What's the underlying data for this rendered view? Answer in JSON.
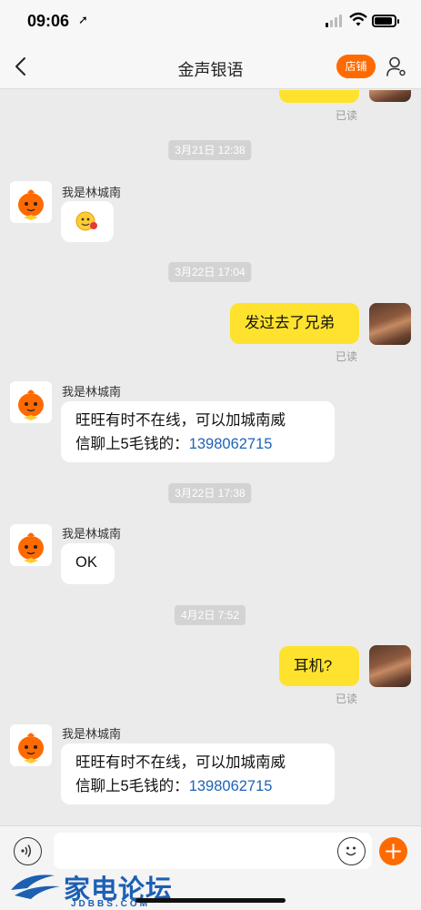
{
  "status_bar": {
    "time": "09:06",
    "arrow": "➚"
  },
  "nav": {
    "title": "金声银语",
    "shop_label": "店铺"
  },
  "messages": {
    "read_label": "已读",
    "sender_name": "我是林城南",
    "time1": "3月21日 12:38",
    "time2": "3月22日 17:04",
    "time3": "3月22日 17:38",
    "time4": "4月2日 7:52",
    "out1": "发过去了兄弟",
    "in_auto_prefix_line1": "旺旺有时不在线，可以加城南威",
    "in_auto_prefix_line2": "信聊上5毛钱的：",
    "phone": "1398062715",
    "ok": "OK",
    "out2": "耳机?"
  },
  "input": {
    "placeholder": ""
  },
  "watermark": {
    "text": "家电论坛",
    "sub": "JDBBS.COM"
  },
  "colors": {
    "accent": "#ff6a00",
    "bubble_out": "#ffe22d",
    "link": "#1e63b8"
  },
  "icons": [
    "back-icon",
    "user-settings-icon",
    "voice-icon",
    "emoji-icon",
    "plus-icon",
    "location-arrow-icon",
    "wifi-icon",
    "battery-icon"
  ]
}
